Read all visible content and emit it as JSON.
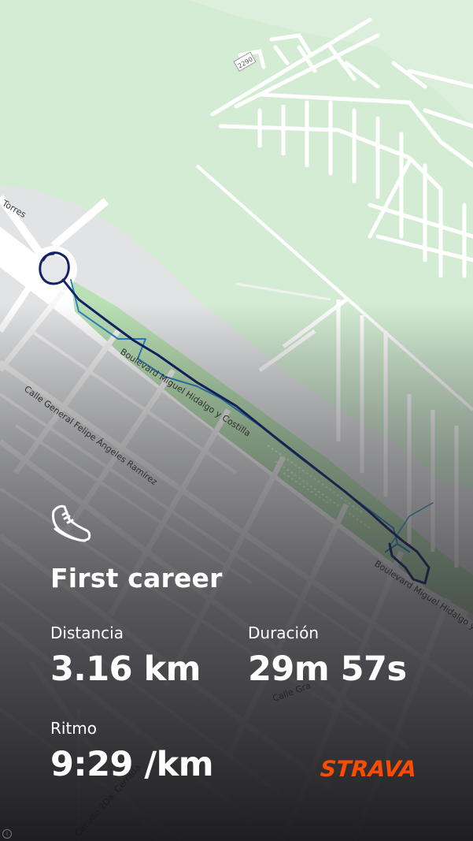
{
  "activity": {
    "title": "First career",
    "type_icon": "running-shoe-icon"
  },
  "stats": {
    "distance": {
      "label": "Distancia",
      "value": "3.16 km"
    },
    "duration": {
      "label": "Duración",
      "value": "29m 57s"
    },
    "pace": {
      "label": "Ritmo",
      "value": "9:29 /km"
    }
  },
  "brand": {
    "name": "STRAVA",
    "color": "#fc4c02"
  },
  "map": {
    "street_labels": {
      "torres": "Torres",
      "boulevard_1": "Boulevard Miguel Hidalgo y Costilla",
      "boulevard_2": "Boulevard Miguel Hidalgo y",
      "calle_general": "Calle General Felipe Ángeles Ramírez",
      "calle_gra": "Calle Gra",
      "circuito": "Circuito 2Da. Cerrada",
      "road_number": "2290"
    },
    "attribution_icon": "info-icon",
    "colors": {
      "park_green": "#c9e9c7",
      "route_dark": "#1a2a6c",
      "route_light": "#3b8fc0",
      "road": "#ffffff"
    }
  }
}
